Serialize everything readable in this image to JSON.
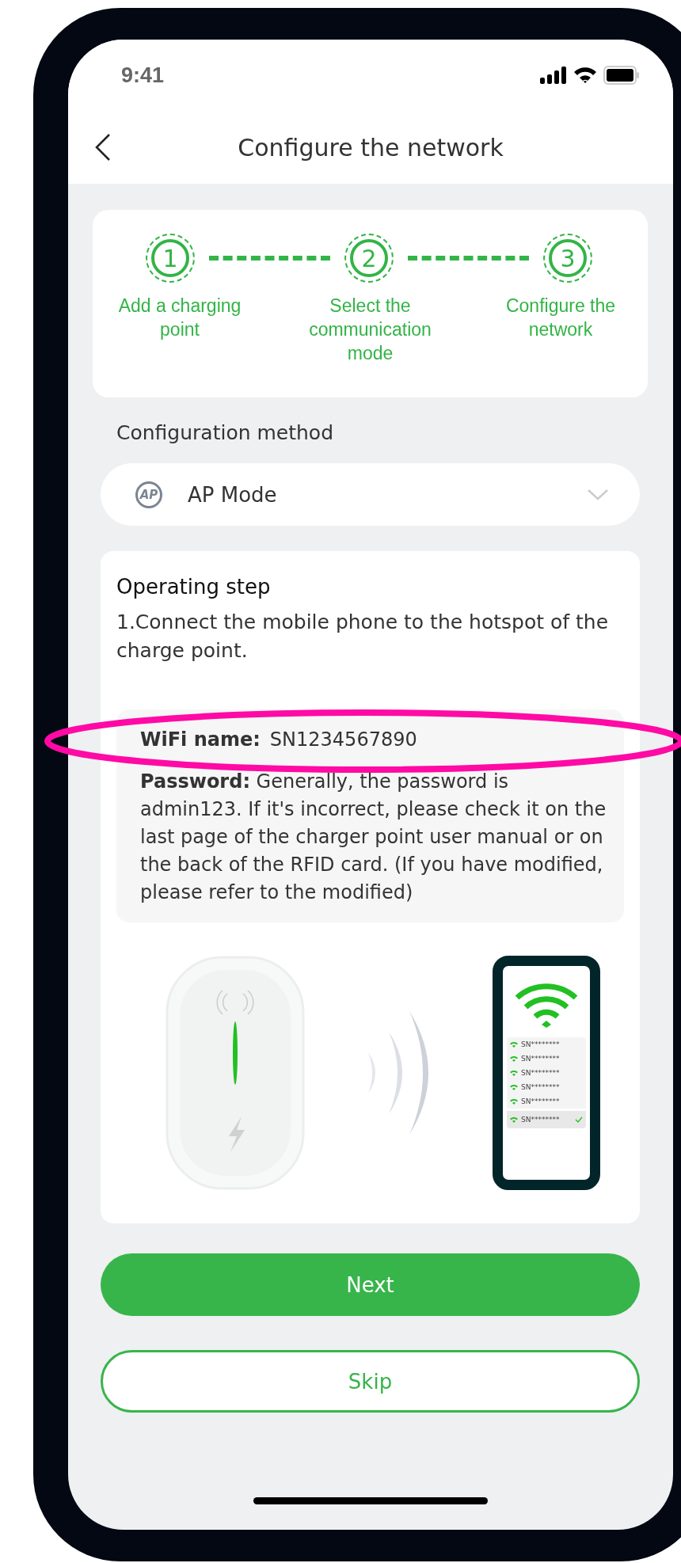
{
  "status_bar": {
    "time": "9:41"
  },
  "header": {
    "title": "Configure the network"
  },
  "steps": [
    {
      "number": "1",
      "label": "Add a charging point"
    },
    {
      "number": "2",
      "label": "Select the communication mode"
    },
    {
      "number": "3",
      "label": "Configure the network"
    }
  ],
  "config": {
    "label": "Configuration method",
    "icon_text": "AP",
    "value": "AP Mode"
  },
  "operating": {
    "title": "Operating step",
    "instruction": "1.Connect the mobile phone to the hotspot of the charge point.",
    "wifi_label": "WiFi name:",
    "wifi_value": "SN1234567890",
    "password_text": "**Password:** Generally, the password is admin123. If it's incorrect, please check it on the last page of the charger point user manual or on the back of the RFID card. (If you have modified, please refer to the modified)",
    "highlighted": true
  },
  "illustration": {
    "networks": [
      {
        "name": "SN********",
        "selected": false
      },
      {
        "name": "SN********",
        "selected": false
      },
      {
        "name": "SN********",
        "selected": false
      },
      {
        "name": "SN********",
        "selected": false
      },
      {
        "name": "SN********",
        "selected": false
      },
      {
        "name": "SN********",
        "selected": true
      }
    ]
  },
  "buttons": {
    "next": "Next",
    "skip": "Skip"
  }
}
